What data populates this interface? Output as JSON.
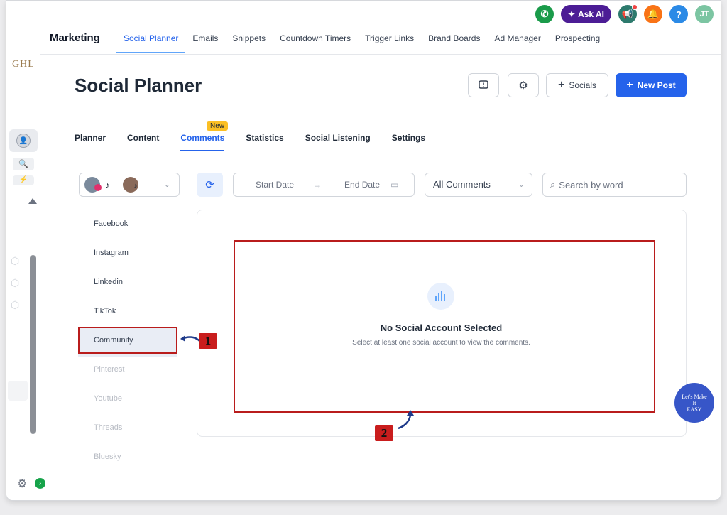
{
  "sidebar": {
    "brand": "GHL",
    "search_icon": "search-icon",
    "gear_icon": "gear-icon"
  },
  "topnav": {
    "section": "Marketing",
    "tabs": [
      {
        "label": "Social Planner",
        "active": true
      },
      {
        "label": "Emails"
      },
      {
        "label": "Snippets"
      },
      {
        "label": "Countdown Timers"
      },
      {
        "label": "Trigger Links"
      },
      {
        "label": "Brand Boards"
      },
      {
        "label": "Ad Manager"
      },
      {
        "label": "Prospecting"
      }
    ],
    "ask_ai": "Ask AI",
    "avatar_initials": "JT",
    "help_label": "?",
    "colors": {
      "phone": "#1a9b4a",
      "askai": "#4c1d95",
      "announce": "#2d7a6d",
      "bell": "#f97316",
      "help": "#2b8ae6",
      "avatar": "#7cc5a2"
    }
  },
  "page": {
    "title": "Social Planner",
    "socials_label": "Socials",
    "new_post_label": "New Post",
    "subtabs": [
      "Planner",
      "Content",
      "Comments",
      "Statistics",
      "Social Listening",
      "Settings"
    ],
    "active_subtab": "Comments",
    "new_badge": "New"
  },
  "filters": {
    "start_date": "Start Date",
    "end_date": "End Date",
    "comments_filter": "All Comments",
    "search_placeholder": "Search by word"
  },
  "platforms": [
    "Facebook",
    "Instagram",
    "Linkedin",
    "TikTok",
    "Community",
    "Pinterest",
    "Youtube",
    "Threads",
    "Bluesky"
  ],
  "selected_platform": "Community",
  "empty_state": {
    "title": "No Social Account Selected",
    "subtitle": "Select at least one social account to view the comments."
  },
  "annotations": {
    "marker_1": "1",
    "marker_2": "2"
  },
  "help_widget": {
    "line1": "Let's Make",
    "line2": "It",
    "line3": "EASY"
  },
  "accent": "#2563eb"
}
